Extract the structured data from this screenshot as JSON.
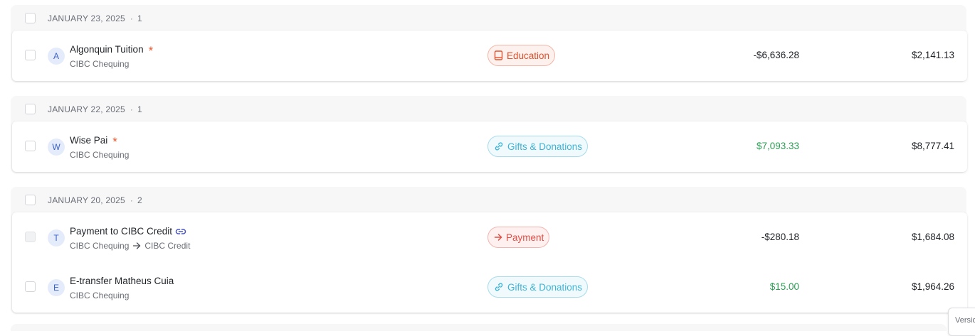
{
  "groups": [
    {
      "date": "JANUARY 23, 2025",
      "count": "1",
      "transactions": [
        {
          "avatar": "A",
          "name": "Algonquin Tuition",
          "needs_review": "*",
          "account": "CIBC Chequing",
          "category": "Education",
          "category_icon": "book-icon",
          "amount": "-$6,636.28",
          "balance": "$2,141.13"
        }
      ]
    },
    {
      "date": "JANUARY 22, 2025",
      "count": "1",
      "transactions": [
        {
          "avatar": "W",
          "name": "Wise Pai",
          "needs_review": "*",
          "account": "CIBC Chequing",
          "category": "Gifts & Donations",
          "category_icon": "gift-link-icon",
          "amount": "$7,093.33",
          "balance": "$8,777.41"
        }
      ]
    },
    {
      "date": "JANUARY 20, 2025",
      "count": "2",
      "transactions": [
        {
          "avatar": "T",
          "name": "Payment to CIBC Credit",
          "account": "CIBC Chequing",
          "transfer_to": "CIBC Credit",
          "category": "Payment",
          "category_icon": "arrow-right-icon",
          "amount": "-$280.18",
          "balance": "$1,684.08"
        },
        {
          "avatar": "E",
          "name": "E-transfer Matheus Cuia",
          "account": "CIBC Chequing",
          "category": "Gifts & Donations",
          "category_icon": "gift-link-icon",
          "amount": "$15.00",
          "balance": "$1,964.26"
        }
      ]
    }
  ],
  "footer": {
    "version_label": "Versio"
  },
  "colors": {
    "positive": "#2d9d55",
    "negative": "#1f2328",
    "review_star": "#f0552b",
    "education": "#e0532f",
    "gifts": "#3fb3d6",
    "payment": "#e04d44"
  }
}
